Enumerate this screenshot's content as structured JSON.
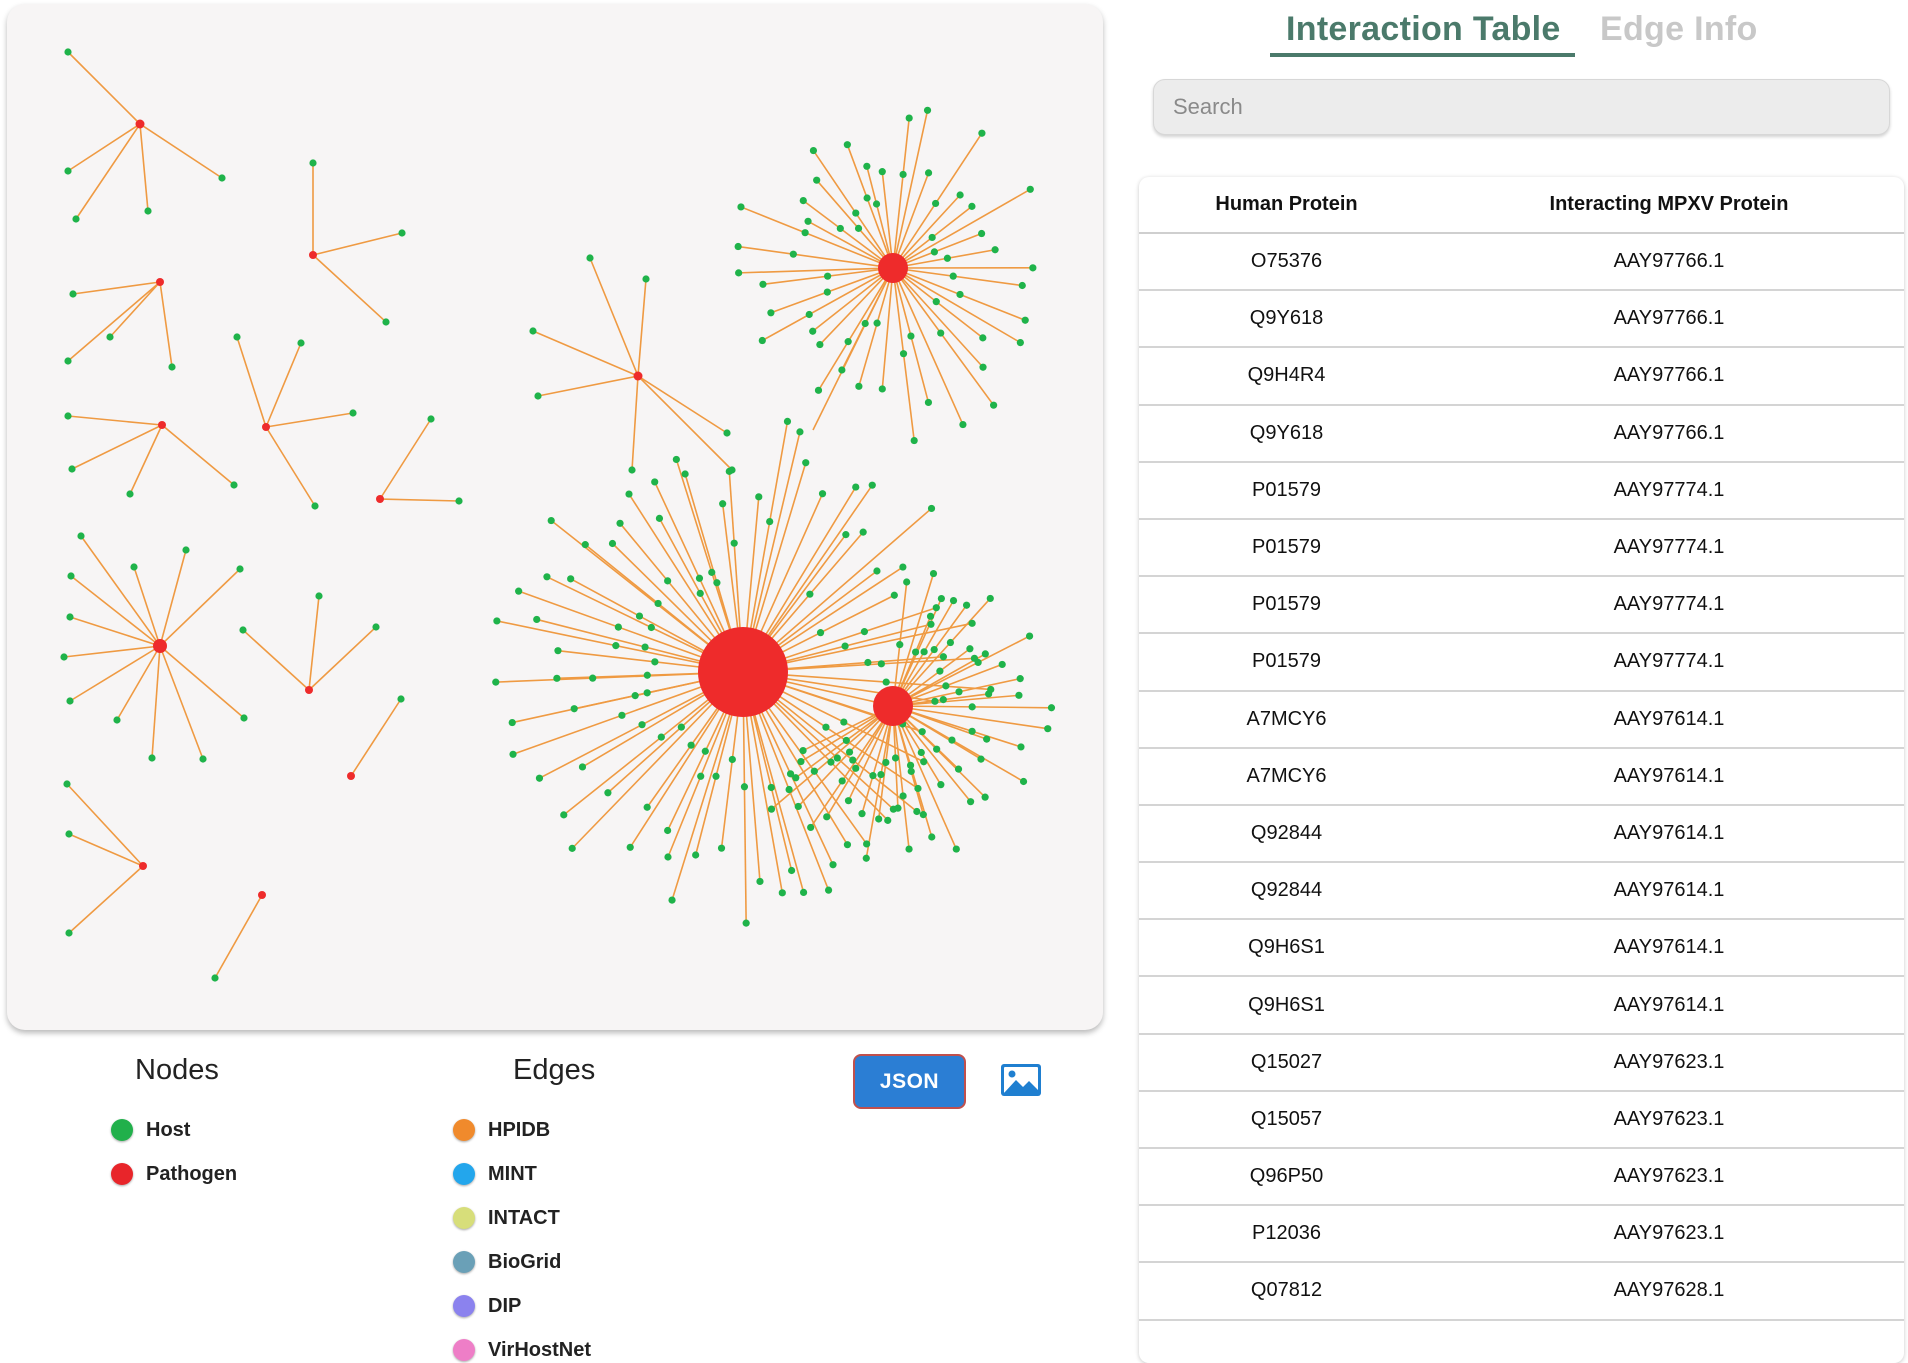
{
  "graph": {
    "colors": {
      "host": "#1fb34a",
      "pathogen": "#ee2b2b",
      "edge": "#ef9a42"
    }
  },
  "legend": {
    "nodes_title": "Nodes",
    "edges_title": "Edges",
    "node_types": [
      {
        "label": "Host",
        "color": "#21b04b"
      },
      {
        "label": "Pathogen",
        "color": "#e8252a"
      }
    ],
    "edge_sources": [
      {
        "label": "HPIDB",
        "color": "#f08a2c"
      },
      {
        "label": "MINT",
        "color": "#23a6ec"
      },
      {
        "label": "INTACT",
        "color": "#d7de7a"
      },
      {
        "label": "BioGrid",
        "color": "#6aa0b7"
      },
      {
        "label": "DIP",
        "color": "#8b82ee"
      },
      {
        "label": "VirHostNet",
        "color": "#ee7ec7"
      }
    ]
  },
  "toolbar": {
    "json_label": "JSON",
    "image_icon": "image-icon"
  },
  "tabs": [
    {
      "label": "Interaction Table",
      "active": true
    },
    {
      "label": "Edge Info",
      "active": false
    }
  ],
  "search": {
    "placeholder": "Search",
    "value": ""
  },
  "table": {
    "columns": [
      "Human Protein",
      "Interacting MPXV Protein"
    ],
    "rows": [
      [
        "O75376",
        "AAY97766.1"
      ],
      [
        "Q9Y618",
        "AAY97766.1"
      ],
      [
        "Q9H4R4",
        "AAY97766.1"
      ],
      [
        "Q9Y618",
        "AAY97766.1"
      ],
      [
        "P01579",
        "AAY97774.1"
      ],
      [
        "P01579",
        "AAY97774.1"
      ],
      [
        "P01579",
        "AAY97774.1"
      ],
      [
        "P01579",
        "AAY97774.1"
      ],
      [
        "A7MCY6",
        "AAY97614.1"
      ],
      [
        "A7MCY6",
        "AAY97614.1"
      ],
      [
        "Q92844",
        "AAY97614.1"
      ],
      [
        "Q92844",
        "AAY97614.1"
      ],
      [
        "Q9H6S1",
        "AAY97614.1"
      ],
      [
        "Q9H6S1",
        "AAY97614.1"
      ],
      [
        "Q15027",
        "AAY97623.1"
      ],
      [
        "Q15057",
        "AAY97623.1"
      ],
      [
        "Q96P50",
        "AAY97623.1"
      ],
      [
        "P12036",
        "AAY97623.1"
      ],
      [
        "Q07812",
        "AAY97628.1"
      ]
    ]
  }
}
